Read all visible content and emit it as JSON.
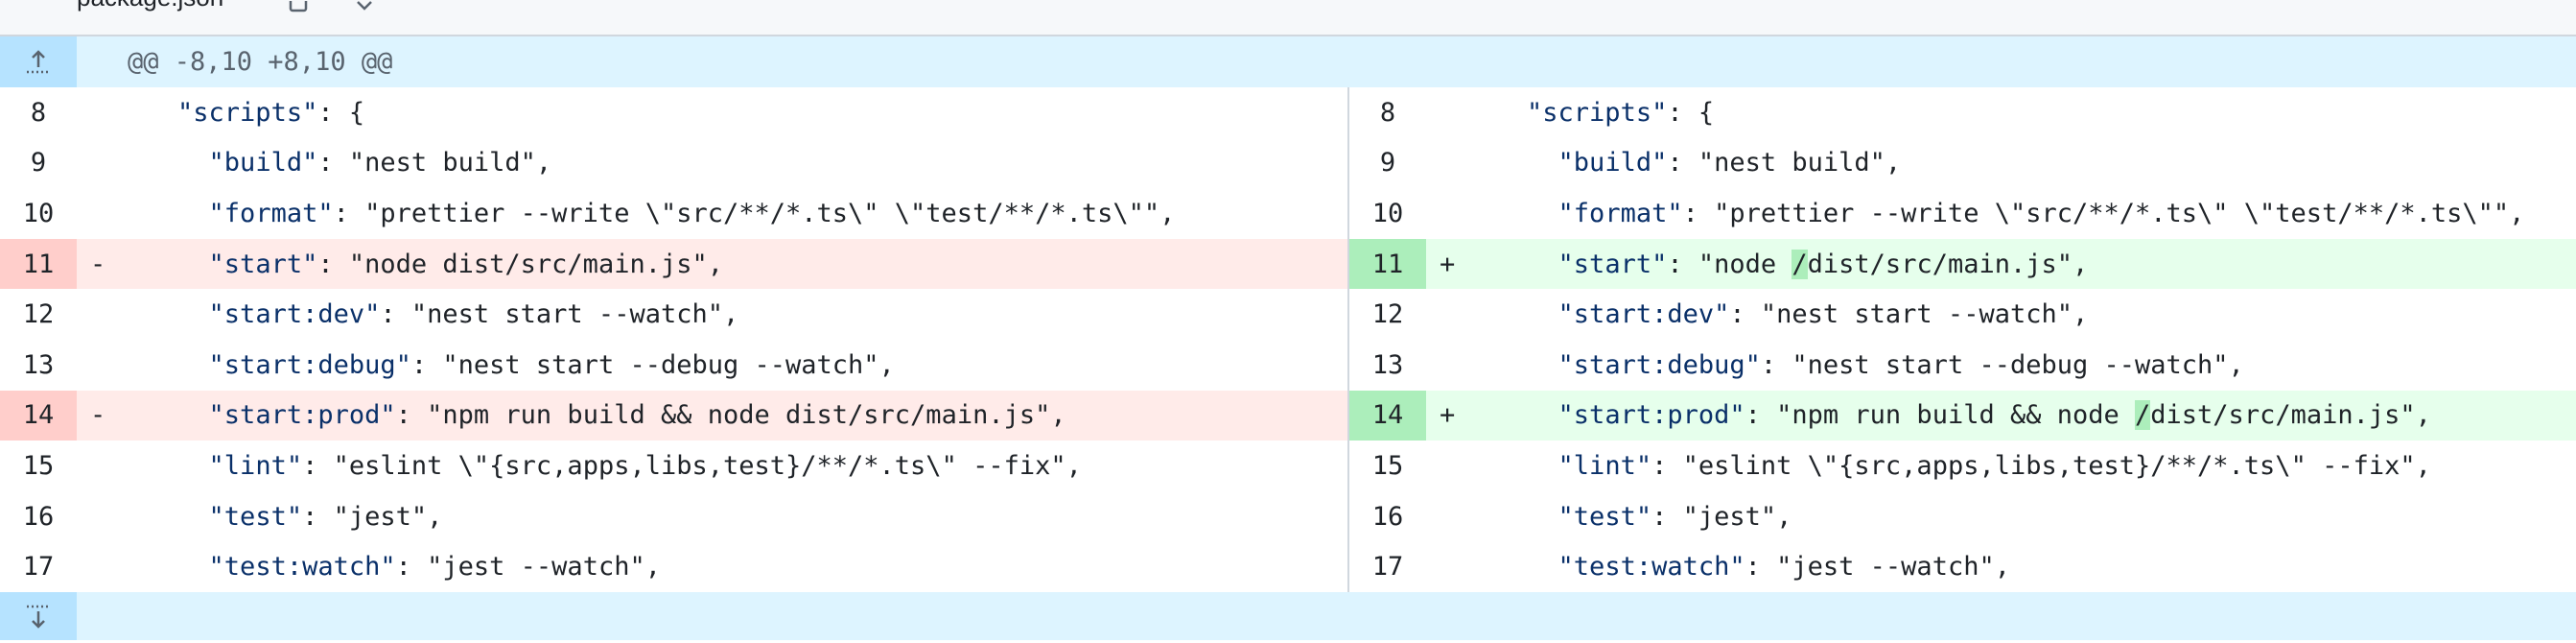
{
  "file": {
    "name": "package.json",
    "copy_icon": "copy-icon",
    "menu_icon": "chevron-down-icon"
  },
  "hunk": {
    "header": "@@ -8,10 +8,10 @@",
    "expand_up_icon": "expand-up-icon",
    "expand_down_icon": "expand-down-icon"
  },
  "left": [
    {
      "num": "8",
      "type": "ctx",
      "marker": "",
      "indent": "    ",
      "key": "\"scripts\"",
      "rest": ": {"
    },
    {
      "num": "9",
      "type": "ctx",
      "marker": "",
      "indent": "      ",
      "key": "\"build\"",
      "rest": ": \"nest build\","
    },
    {
      "num": "10",
      "type": "ctx",
      "marker": "",
      "indent": "      ",
      "key": "\"format\"",
      "rest": ": \"prettier --write \\\"src/**/*.ts\\\" \\\"test/**/*.ts\\\"\","
    },
    {
      "num": "11",
      "type": "del",
      "marker": "-",
      "indent": "      ",
      "key": "\"start\"",
      "rest": ": \"node dist/src/main.js\","
    },
    {
      "num": "12",
      "type": "ctx",
      "marker": "",
      "indent": "      ",
      "key": "\"start:dev\"",
      "rest": ": \"nest start --watch\","
    },
    {
      "num": "13",
      "type": "ctx",
      "marker": "",
      "indent": "      ",
      "key": "\"start:debug\"",
      "rest": ": \"nest start --debug --watch\","
    },
    {
      "num": "14",
      "type": "del",
      "marker": "-",
      "indent": "      ",
      "key": "\"start:prod\"",
      "rest": ": \"npm run build && node dist/src/main.js\","
    },
    {
      "num": "15",
      "type": "ctx",
      "marker": "",
      "indent": "      ",
      "key": "\"lint\"",
      "rest": ": \"eslint \\\"{src,apps,libs,test}/**/*.ts\\\" --fix\","
    },
    {
      "num": "16",
      "type": "ctx",
      "marker": "",
      "indent": "      ",
      "key": "\"test\"",
      "rest": ": \"jest\","
    },
    {
      "num": "17",
      "type": "ctx",
      "marker": "",
      "indent": "      ",
      "key": "\"test:watch\"",
      "rest": ": \"jest --watch\","
    }
  ],
  "right": [
    {
      "num": "8",
      "type": "ctx",
      "marker": "",
      "indent": "    ",
      "key": "\"scripts\"",
      "rest": ": {"
    },
    {
      "num": "9",
      "type": "ctx",
      "marker": "",
      "indent": "      ",
      "key": "\"build\"",
      "rest": ": \"nest build\","
    },
    {
      "num": "10",
      "type": "ctx",
      "marker": "",
      "indent": "      ",
      "key": "\"format\"",
      "rest": ": \"prettier --write \\\"src/**/*.ts\\\" \\\"test/**/*.ts\\\"\","
    },
    {
      "num": "11",
      "type": "add",
      "marker": "+",
      "indent": "      ",
      "key": "\"start\"",
      "rest_pre": ": \"node ",
      "hl": "/",
      "rest_post": "dist/src/main.js\","
    },
    {
      "num": "12",
      "type": "ctx",
      "marker": "",
      "indent": "      ",
      "key": "\"start:dev\"",
      "rest": ": \"nest start --watch\","
    },
    {
      "num": "13",
      "type": "ctx",
      "marker": "",
      "indent": "      ",
      "key": "\"start:debug\"",
      "rest": ": \"nest start --debug --watch\","
    },
    {
      "num": "14",
      "type": "add",
      "marker": "+",
      "indent": "      ",
      "key": "\"start:prod\"",
      "rest_pre": ": \"npm run build && node ",
      "hl": "/",
      "rest_post": "dist/src/main.js\","
    },
    {
      "num": "15",
      "type": "ctx",
      "marker": "",
      "indent": "      ",
      "key": "\"lint\"",
      "rest": ": \"eslint \\\"{src,apps,libs,test}/**/*.ts\\\" --fix\","
    },
    {
      "num": "16",
      "type": "ctx",
      "marker": "",
      "indent": "      ",
      "key": "\"test\"",
      "rest": ": \"jest\","
    },
    {
      "num": "17",
      "type": "ctx",
      "marker": "",
      "indent": "      ",
      "key": "\"test:watch\"",
      "rest": ": \"jest --watch\","
    }
  ]
}
